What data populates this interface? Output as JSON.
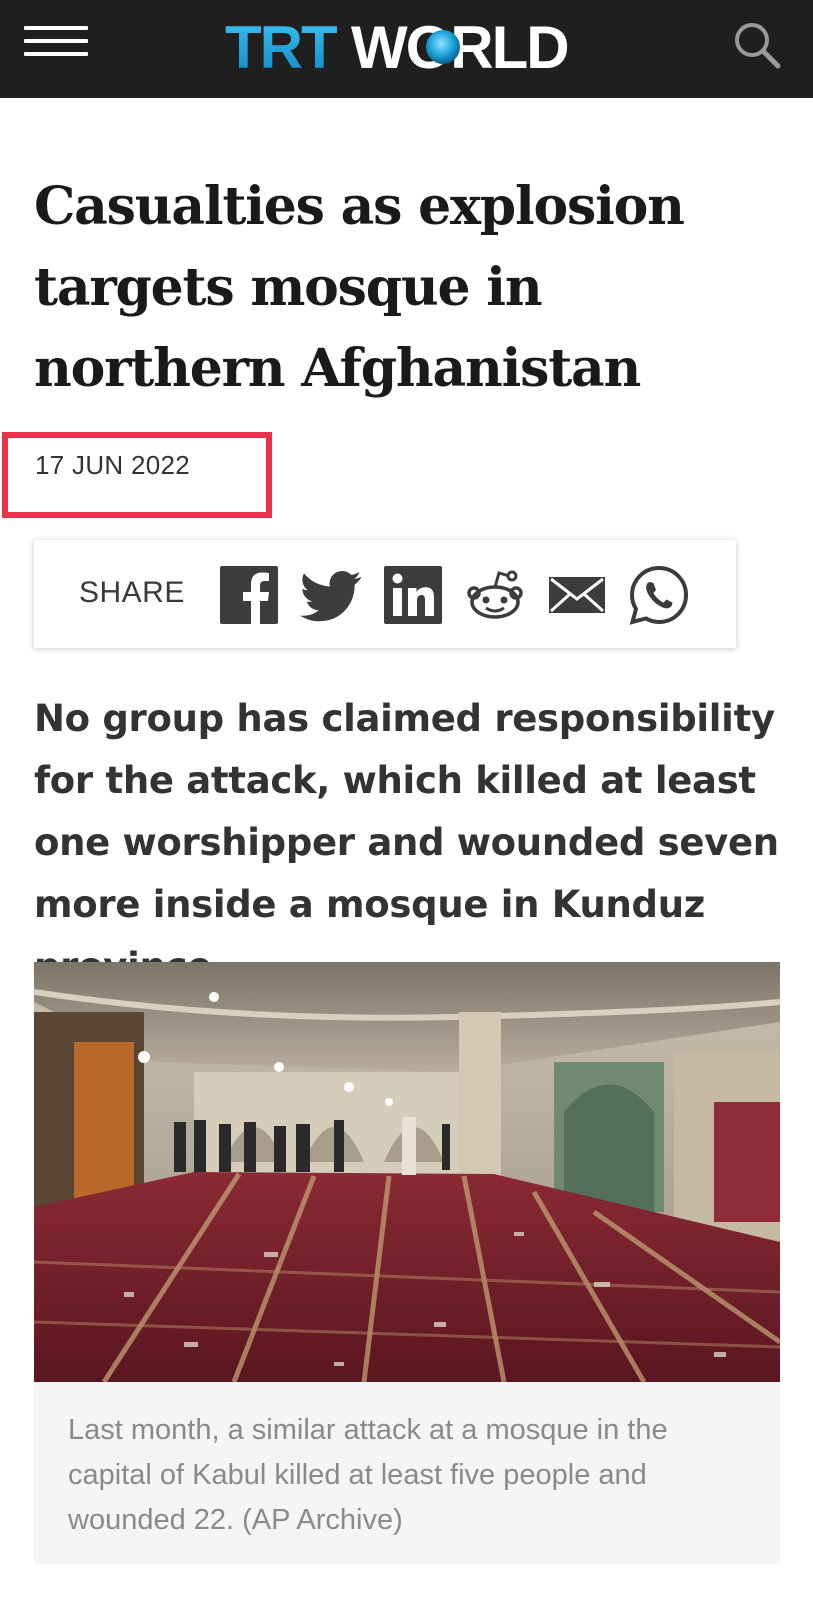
{
  "header": {
    "logo_text_1": "TRT",
    "logo_text_2": "WORLD",
    "menu_icon": "hamburger-menu-icon",
    "search_icon": "search-icon",
    "bg_color": "#1f1f1f",
    "logo_blue": "#1aa3d9"
  },
  "article": {
    "headline": "Casualties as explosion targets mosque in northern Afghanistan",
    "date": "17 JUN 2022",
    "highlight_color": "#e8324a",
    "lede": "No group has claimed responsibility for the attack, which killed at least one worshipper and wounded seven more inside a mosque in Kunduz province."
  },
  "share": {
    "label": "SHARE",
    "buttons": [
      {
        "icon": "facebook-icon"
      },
      {
        "icon": "twitter-icon"
      },
      {
        "icon": "linkedin-icon"
      },
      {
        "icon": "reddit-icon"
      },
      {
        "icon": "email-icon"
      },
      {
        "icon": "whatsapp-icon"
      }
    ]
  },
  "figure": {
    "caption": "Last month, a similar attack at a mosque in the capital of Kabul killed at least five people and wounded 22. (AP Archive)"
  }
}
